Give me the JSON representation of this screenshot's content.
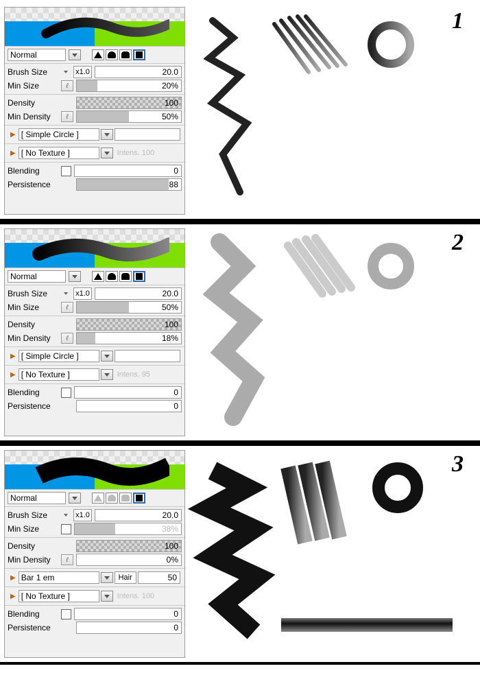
{
  "sections": [
    {
      "num": "1",
      "blend_mode": "Normal",
      "shape_selected": 3,
      "shapes_dim": false,
      "brush_size": {
        "label": "Brush Size",
        "mult": "x1.0",
        "value": "20.0"
      },
      "min_size": {
        "label": "Min Size",
        "pct": "20%",
        "fill": 20,
        "press": true,
        "check": false
      },
      "density": {
        "label": "Density",
        "value": "100",
        "fill": 100
      },
      "min_density": {
        "label": "Min Density",
        "pct": "50%",
        "fill": 50,
        "press": true,
        "check": false
      },
      "tip": {
        "name": "[ Simple Circle ]",
        "extra": null
      },
      "texture": {
        "name": "[ No Texture ]",
        "intens_label": "Intens.",
        "intens_val": "100"
      },
      "blending": {
        "label": "Blending",
        "value": "0",
        "fill": 0,
        "check": false
      },
      "persistence": {
        "label": "Persistence",
        "value": "88",
        "fill": 88,
        "check": null
      }
    },
    {
      "num": "2",
      "blend_mode": "Normal",
      "shape_selected": 3,
      "shapes_dim": false,
      "brush_size": {
        "label": "Brush Size",
        "mult": "x1.0",
        "value": "20.0"
      },
      "min_size": {
        "label": "Min Size",
        "pct": "50%",
        "fill": 50,
        "press": true,
        "check": false
      },
      "density": {
        "label": "Density",
        "value": "100",
        "fill": 100
      },
      "min_density": {
        "label": "Min Density",
        "pct": "18%",
        "fill": 18,
        "press": true,
        "check": false
      },
      "tip": {
        "name": "[ Simple Circle ]",
        "extra": null
      },
      "texture": {
        "name": "[ No Texture ]",
        "intens_label": "Intens.",
        "intens_val": "95"
      },
      "blending": {
        "label": "Blending",
        "value": "0",
        "fill": 0,
        "check": false
      },
      "persistence": {
        "label": "Persistence",
        "value": "0",
        "fill": 0,
        "check": null
      }
    },
    {
      "num": "3",
      "blend_mode": "Normal",
      "shape_selected": 3,
      "shapes_dim": true,
      "brush_size": {
        "label": "Brush Size",
        "mult": "x1.0",
        "value": "20.0"
      },
      "min_size": {
        "label": "Min Size",
        "pct": "38%",
        "fill": 38,
        "press": false,
        "check": false,
        "dim": true
      },
      "density": {
        "label": "Density",
        "value": "100",
        "fill": 100
      },
      "min_density": {
        "label": "Min Density",
        "pct": "0%",
        "fill": 0,
        "press": true,
        "check": false
      },
      "tip": {
        "name": "Bar 1 em",
        "extra": {
          "label": "Hair",
          "value": "50"
        }
      },
      "texture": {
        "name": "[ No Texture ]",
        "intens_label": "Intens.",
        "intens_val": "100"
      },
      "blending": {
        "label": "Blending",
        "value": "0",
        "fill": 0,
        "check": false
      },
      "persistence": {
        "label": "Persistence",
        "value": "0",
        "fill": 0,
        "check": null
      }
    }
  ]
}
